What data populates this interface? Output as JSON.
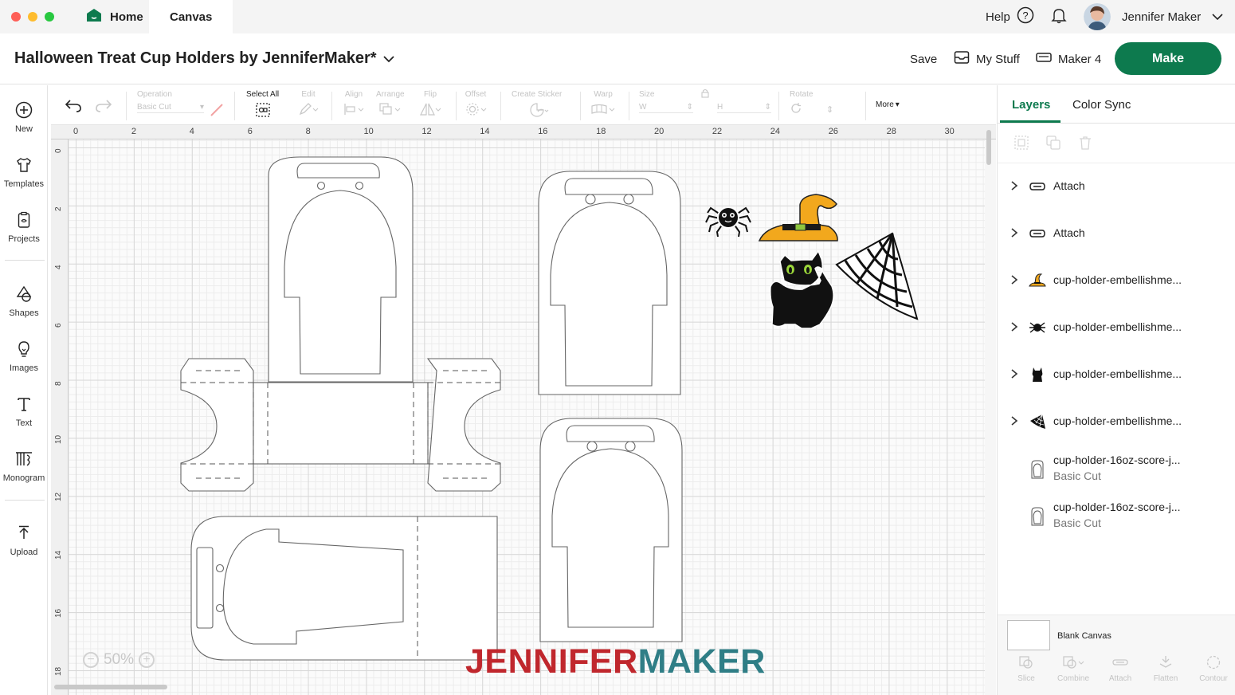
{
  "window": {
    "traffic_lights": [
      "#fe5f57",
      "#febc2e",
      "#28c840"
    ]
  },
  "tabs": {
    "home": "Home",
    "canvas": "Canvas"
  },
  "topbar": {
    "help": "Help",
    "user_name": "Jennifer Maker"
  },
  "titlebar": {
    "project_title": "Halloween Treat Cup Holders by JenniferMaker*",
    "save": "Save",
    "my_stuff": "My Stuff",
    "machine": "Maker 4",
    "make": "Make",
    "accent": "#0d7a4e"
  },
  "leftrail": {
    "new": "New",
    "templates": "Templates",
    "projects": "Projects",
    "shapes": "Shapes",
    "images": "Images",
    "text": "Text",
    "monogram": "Monogram",
    "upload": "Upload"
  },
  "toolbar": {
    "operation": "Operation",
    "operation_value": "Basic Cut",
    "select_all": "Select All",
    "edit": "Edit",
    "align": "Align",
    "arrange": "Arrange",
    "flip": "Flip",
    "offset": "Offset",
    "create_sticker": "Create Sticker",
    "warp": "Warp",
    "size": "Size",
    "size_w": "W",
    "size_h": "H",
    "rotate": "Rotate",
    "more": "More"
  },
  "canvas": {
    "ruler_top": [
      "0",
      "2",
      "4",
      "6",
      "8",
      "10",
      "12",
      "14",
      "16",
      "18",
      "20",
      "22",
      "24",
      "26",
      "28",
      "30"
    ],
    "ruler_left": [
      "0",
      "2",
      "4",
      "6",
      "8",
      "10",
      "12",
      "14",
      "16",
      "18"
    ],
    "zoom": "50%",
    "zoom_minus": "−",
    "zoom_plus": "+",
    "brand_part1": "JENNIFER",
    "brand_part2": "MAKER",
    "brand_color1": "#c0272d",
    "brand_color2": "#2f7e86"
  },
  "panel": {
    "tab_layers": "Layers",
    "tab_colorsync": "Color Sync",
    "layers": [
      {
        "name": "Attach",
        "sub": "",
        "icon": "attach-icon",
        "expand": true
      },
      {
        "name": "Attach",
        "sub": "",
        "icon": "attach-icon",
        "expand": true
      },
      {
        "name": "cup-holder-embellishme...",
        "sub": "",
        "icon": "witch-hat-icon",
        "expand": true
      },
      {
        "name": "cup-holder-embellishme...",
        "sub": "",
        "icon": "spider-icon",
        "expand": true
      },
      {
        "name": "cup-holder-embellishme...",
        "sub": "",
        "icon": "cat-icon",
        "expand": true
      },
      {
        "name": "cup-holder-embellishme...",
        "sub": "",
        "icon": "spiderweb-icon",
        "expand": true
      },
      {
        "name": "cup-holder-16oz-score-j...",
        "sub": "Basic Cut",
        "icon": "cup-outline-icon",
        "expand": false
      },
      {
        "name": "cup-holder-16oz-score-j...",
        "sub": "Basic Cut",
        "icon": "cup-outline-icon",
        "expand": false
      }
    ],
    "blank_canvas": "Blank Canvas",
    "tools": [
      "Slice",
      "Combine",
      "Attach",
      "Flatten",
      "Contour"
    ]
  }
}
